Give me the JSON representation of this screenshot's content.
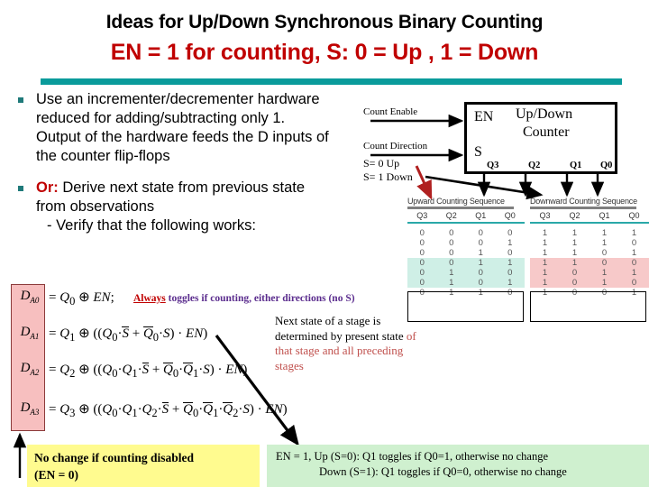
{
  "slide": {
    "title_line1": "Ideas for Up/Down Synchronous Binary Counting",
    "title_line2": "EN = 1 for counting, S: 0 = Up , 1 = Down",
    "accent_teal": "#0A9B9B",
    "title_red": "#C00000"
  },
  "bullets": [
    {
      "lead": "",
      "text": "Use an incrementer/decrementer hardware reduced for adding/subtracting only 1. Output of the hardware feeds the D inputs of the counter flip-flops"
    },
    {
      "lead": "Or:",
      "text": "Derive next state from previous state from observations",
      "sub": "- Verify that the following works:"
    }
  ],
  "diagram": {
    "count_enable_label": "Count Enable",
    "count_direction_label": "Count Direction",
    "s0_label": "S= 0 Up",
    "s1_label": "S= 1 Down",
    "en_pin": "EN",
    "s_pin": "S",
    "box_title_line1": "Up/Down",
    "box_title_line2": "Counter",
    "outputs": [
      "Q3",
      "Q2",
      "Q1",
      "Q0"
    ]
  },
  "tables": {
    "upward": {
      "title": "Upward Counting Sequence",
      "columns": [
        "Q3",
        "Q2",
        "Q1",
        "Q0"
      ],
      "rows": [
        [
          "0",
          "0",
          "0",
          "0"
        ],
        [
          "0",
          "0",
          "0",
          "1"
        ],
        [
          "0",
          "0",
          "1",
          "0"
        ],
        [
          "0",
          "0",
          "1",
          "1"
        ],
        [
          "0",
          "1",
          "0",
          "0"
        ],
        [
          "0",
          "1",
          "0",
          "1"
        ],
        [
          "0",
          "1",
          "1",
          "0"
        ]
      ],
      "highlight_rows": [
        3,
        4,
        5
      ],
      "highlight_color": "#CFEFE6"
    },
    "downward": {
      "title": "Downward Counting Sequence",
      "columns": [
        "Q3",
        "Q2",
        "Q1",
        "Q0"
      ],
      "rows": [
        [
          "1",
          "1",
          "1",
          "1"
        ],
        [
          "1",
          "1",
          "1",
          "0"
        ],
        [
          "1",
          "1",
          "0",
          "1"
        ],
        [
          "1",
          "1",
          "0",
          "0"
        ],
        [
          "1",
          "0",
          "1",
          "1"
        ],
        [
          "1",
          "0",
          "1",
          "0"
        ],
        [
          "1",
          "0",
          "0",
          "1"
        ]
      ],
      "highlight_rows": [
        3,
        4,
        5
      ],
      "highlight_color": "#F7C9C9"
    }
  },
  "equations": {
    "labels": [
      "D_A0",
      "D_A1",
      "D_A2",
      "D_A3"
    ],
    "d_a0": "= Q0 ⊕ EN;",
    "d_a1": "= Q1 ⊕ ((Q0 · S̅ + Q̅0 · S) · EN)",
    "d_a2": "= Q2 ⊕ ((Q0 · Q1 · S̅ + Q̅0 · Q̅1 · S) · EN)",
    "d_a3": "= Q3 ⊕ ((Q0 · Q1 · Q2 · S̅ + Q̅0 · Q̅1 · Q̅2 · S) · EN)",
    "always_note_underlined": "Always",
    "always_note": " toggles if counting, either directions (no S)",
    "box_color": "#F7BFBF"
  },
  "notes": {
    "next_state_black": "Next state of a stage is determined by present state ",
    "next_state_red": "of that stage and all preceding stages"
  },
  "callouts": {
    "yellow_line1": "No change if counting disabled",
    "yellow_line2": "(EN = 0)",
    "yellow_color": "#FFFB8F",
    "green_line1": "EN = 1, Up (S=0): Q1 toggles if Q0=1, otherwise no change",
    "green_line2": "Down (S=1): Q1 toggles if Q0=0, otherwise no change",
    "green_color": "#CFF0CF"
  }
}
